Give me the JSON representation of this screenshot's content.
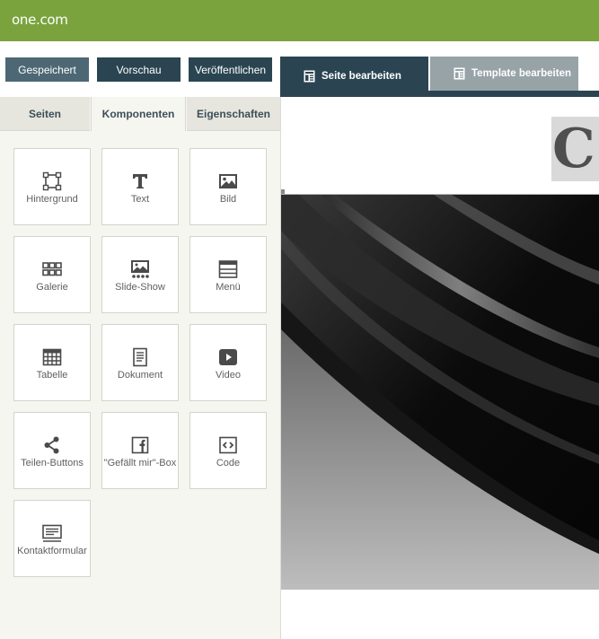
{
  "brand": {
    "logo_text": "one.com",
    "bar_color": "#7aa33e"
  },
  "toolbar": {
    "saved_label": "Gespeichert",
    "preview_label": "Vorschau",
    "publish_label": "Veröffentlichen"
  },
  "modes": {
    "edit_page_label": "Seite bearbeiten",
    "edit_template_label": "Template bearbeiten",
    "edit_page_icon": "page-layout-icon",
    "edit_template_icon": "template-layout-icon"
  },
  "sidebar": {
    "tabs": [
      {
        "label": "Seiten",
        "active": false
      },
      {
        "label": "Komponenten",
        "active": true
      },
      {
        "label": "Eigenschaften",
        "active": false
      }
    ],
    "components": [
      {
        "label": "Hintergrund",
        "icon": "background-frame-icon"
      },
      {
        "label": "Text",
        "icon": "text-t-icon"
      },
      {
        "label": "Bild",
        "icon": "image-icon"
      },
      {
        "label": "Galerie",
        "icon": "gallery-grid-icon"
      },
      {
        "label": "Slide-Show",
        "icon": "slideshow-icon"
      },
      {
        "label": "Menü",
        "icon": "menu-list-icon"
      },
      {
        "label": "Tabelle",
        "icon": "table-icon"
      },
      {
        "label": "Dokument",
        "icon": "document-icon"
      },
      {
        "label": "Video",
        "icon": "video-play-icon"
      },
      {
        "label": "Teilen-Buttons",
        "icon": "share-icon"
      },
      {
        "label": "\"Gefällt mir\"-Box",
        "icon": "facebook-icon"
      },
      {
        "label": "Code",
        "icon": "code-icon"
      },
      {
        "label": "Kontaktformular",
        "icon": "contact-form-icon"
      }
    ]
  },
  "canvas": {
    "brand_initial": "C"
  },
  "colors": {
    "dark_accent": "#2a4551",
    "saved_button": "#4d6874",
    "inactive_mode_tab": "#98a3a7",
    "sidebar_bg": "#f6f6f1"
  }
}
